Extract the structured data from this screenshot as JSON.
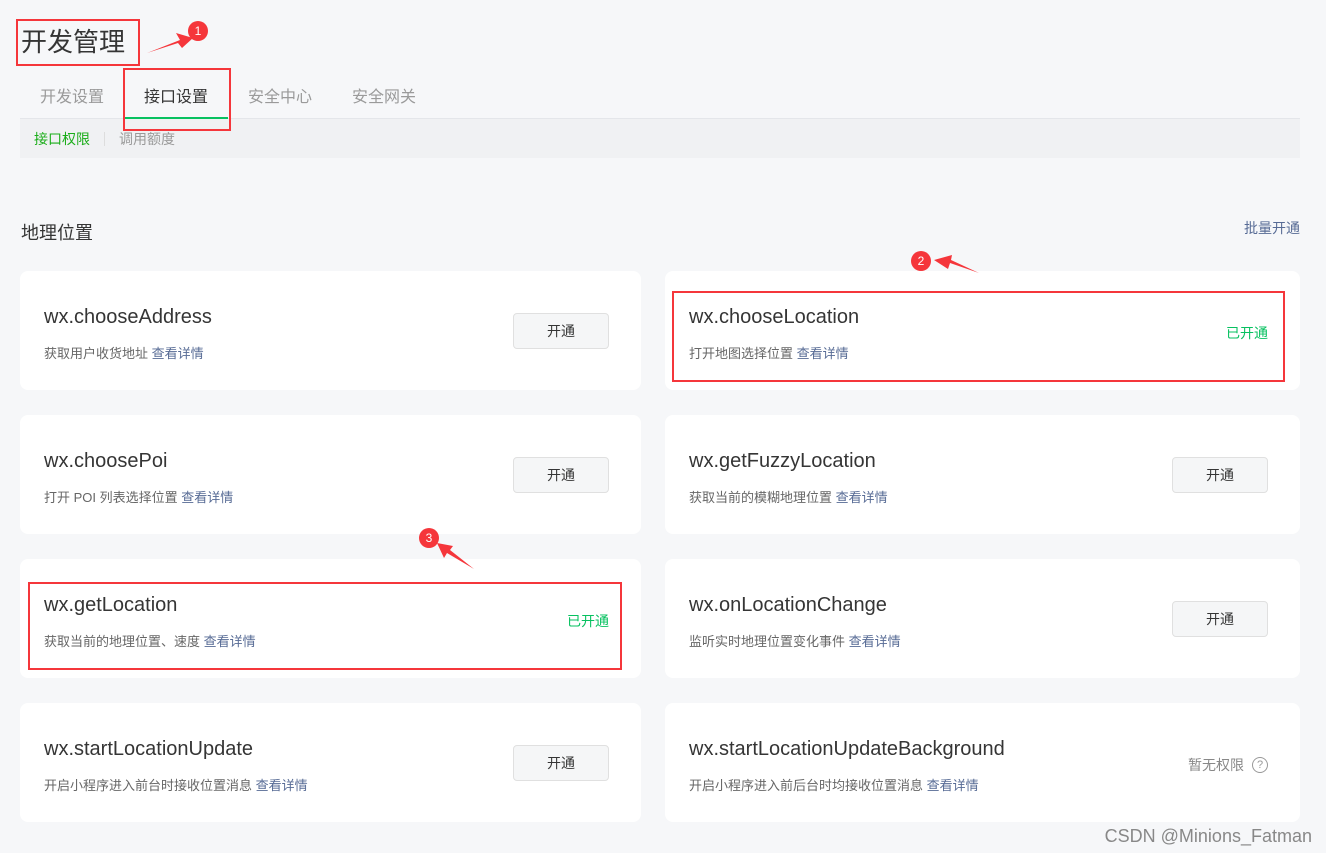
{
  "page_title": "开发管理",
  "tabs": [
    {
      "label": "开发设置"
    },
    {
      "label": "接口设置"
    },
    {
      "label": "安全中心"
    },
    {
      "label": "安全网关"
    }
  ],
  "subnav": [
    {
      "label": "接口权限"
    },
    {
      "label": "调用额度"
    }
  ],
  "section": {
    "title": "地理位置",
    "batch_label": "批量开通"
  },
  "detail_link": "查看详情",
  "cards": [
    {
      "name": "wx.chooseAddress",
      "desc": "获取用户收货地址",
      "status": "开通"
    },
    {
      "name": "wx.chooseLocation",
      "desc": "打开地图选择位置",
      "status": "已开通"
    },
    {
      "name": "wx.choosePoi",
      "desc": "打开 POI 列表选择位置",
      "status": "开通"
    },
    {
      "name": "wx.getFuzzyLocation",
      "desc": "获取当前的模糊地理位置",
      "status": "开通"
    },
    {
      "name": "wx.getLocation",
      "desc": "获取当前的地理位置、速度",
      "status": "已开通"
    },
    {
      "name": "wx.onLocationChange",
      "desc": "监听实时地理位置变化事件",
      "status": "开通"
    },
    {
      "name": "wx.startLocationUpdate",
      "desc": "开启小程序进入前台时接收位置消息",
      "status": "开通"
    },
    {
      "name": "wx.startLocationUpdateBackground",
      "desc": "开启小程序进入前后台时均接收位置消息",
      "status": "暂无权限"
    }
  ],
  "annotations": [
    "1",
    "2",
    "3"
  ],
  "watermark": "CSDN @Minions_Fatman",
  "colors": {
    "accent": "#07c160",
    "link": "#576b95",
    "annotation": "#f5363b"
  }
}
